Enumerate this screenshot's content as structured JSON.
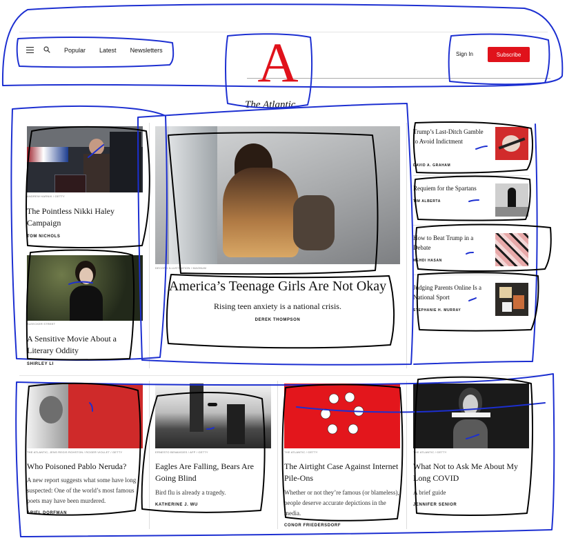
{
  "header": {
    "nav": {
      "popular": "Popular",
      "latest": "Latest",
      "newsletters": "Newsletters"
    },
    "logo_letter": "A",
    "wordmark": "The Atlantic",
    "sign_in": "Sign In",
    "subscribe": "Subscribe"
  },
  "left_column": [
    {
      "credit": "ANDREW HARNIK / GETTY",
      "title": "The Pointless Nikki Haley Campaign",
      "author": "TOM NICHOLS"
    },
    {
      "credit": "BLEECKER STREET",
      "title": "A Sensitive Movie About a Literary Oddity",
      "author": "SHIRLEY LI"
    }
  ],
  "feature": {
    "credit": "DECORD ILLUSTRATION / MAGNUM",
    "title": "America’s Teenage Girls Are Not Okay",
    "dek": "Rising teen anxiety is a national crisis.",
    "author": "DEREK THOMPSON"
  },
  "right_column": [
    {
      "title": "Trump’s Last-Ditch Gamble to Avoid Indictment",
      "author": "DAVID A. GRAHAM"
    },
    {
      "title": "Requiem for the Spartans",
      "author": "TIM ALBERTA"
    },
    {
      "title": "How to Beat Trump in a Debate",
      "author": "MEHDI HASAN"
    },
    {
      "title": "Judging Parents Online Is a National Sport",
      "author": "STEPHANIE H. MURRAY"
    }
  ],
  "bottom_row": [
    {
      "credit": "THE ATLANTIC; JENS REGIS ROHSTON / ROGER VIOLLET / GETTY",
      "title": "Who Poisoned Pablo Neruda?",
      "dek": "A new report suggests what some have long suspected: One of the world’s most famous poets may have been murdered.",
      "author": "ARIEL DORFMAN"
    },
    {
      "credit": "ERNESTO BENAVIDES / AFP / GETTY",
      "title": "Eagles Are Falling, Bears Are Going Blind",
      "dek": "Bird flu is already a tragedy.",
      "author": "KATHERINE J. WU"
    },
    {
      "credit": "THE ATLANTIC / GETTY",
      "title": "The Airtight Case Against Internet Pile-Ons",
      "dek": "Whether or not they’re famous (or blameless), people deserve accurate depictions in the media.",
      "author": "CONOR FRIEDERSDORF"
    },
    {
      "credit": "THE ATLANTIC / GETTY",
      "title": "What Not to Ask Me About My Long COVID",
      "dek": "A brief guide",
      "author": "JENNIFER SENIOR"
    }
  ],
  "colors": {
    "brand_red": "#e0121b",
    "scribble_blue": "#1c2fd1",
    "scribble_black": "#000000"
  }
}
